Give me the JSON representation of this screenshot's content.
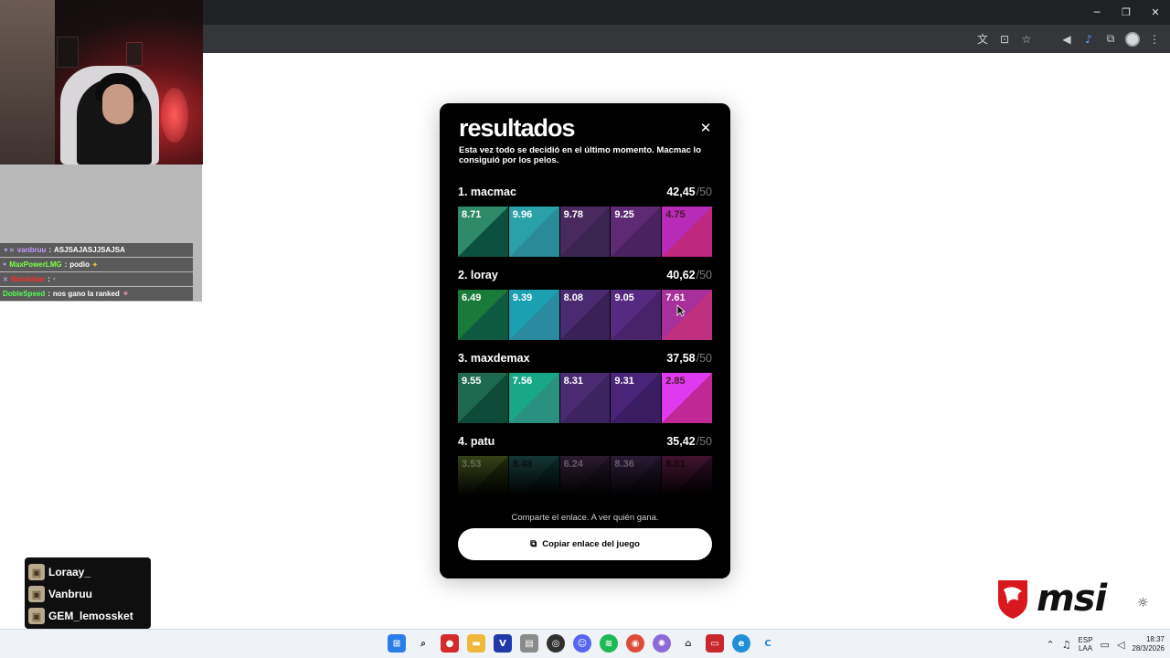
{
  "window": {
    "minimize": "─",
    "restore": "❐",
    "close": "✕"
  },
  "toolbar": {
    "icons": [
      "translate-icon",
      "install-app-icon",
      "star-icon",
      "mute-icon",
      "audio-icon",
      "extensions-icon",
      "profile-icon",
      "menu-icon"
    ]
  },
  "chat": {
    "messages": [
      {
        "user": "vanbruu",
        "color": "#c69cff",
        "text": "ASJSAJASJJSAJSA"
      },
      {
        "user": "MaxPowerLMG",
        "color": "#7dff4a",
        "text": "podio"
      },
      {
        "user": "Nandobar",
        "color": "#ff2a2a",
        "text": ""
      },
      {
        "user": "DobleSpeed",
        "color": "#55ff55",
        "text": "nos gano la ranked"
      }
    ]
  },
  "viewers": [
    "Loraay_",
    "Vanbruu",
    "GEM_lemossket"
  ],
  "brand": {
    "msi": "msi"
  },
  "results": {
    "title": "resultados",
    "subtitle": "Esta vez todo se decidió en el último momento. Macmac lo consiguió por los pelos.",
    "max_label": "/50",
    "players": [
      {
        "rank_name": "1. macmac",
        "score": "42,45",
        "values": [
          "8.71",
          "9.96",
          "9.78",
          "9.25",
          "4.75"
        ]
      },
      {
        "rank_name": "2. loray",
        "score": "40,62",
        "values": [
          "6.49",
          "9.39",
          "8.08",
          "9.05",
          "7.61"
        ]
      },
      {
        "rank_name": "3. maxdemax",
        "score": "37,58",
        "values": [
          "9.55",
          "7.56",
          "8.31",
          "9.31",
          "2.85"
        ]
      },
      {
        "rank_name": "4. patu",
        "score": "35,42",
        "values": [
          "3.53",
          "8.48",
          "6.24",
          "8.36",
          "8.81"
        ]
      }
    ],
    "share_text": "Comparte el enlace. A ver quién gana.",
    "copy_button": "Copiar enlace del juego"
  },
  "tile_colors": [
    [
      "#2e8a68",
      "#0c5040",
      "#2aa0a8",
      "#2a8a98",
      "#4a2a5e",
      "#3a2450",
      "#5e2a74",
      "#4a2262",
      "#b82ab8",
      "#c02880"
    ],
    [
      "#1a7a3a",
      "#0e5a40",
      "#1aa0b0",
      "#2a8aa0",
      "#4a2a70",
      "#3a2258",
      "#562a80",
      "#48226a",
      "#a8309a",
      "#c0307e"
    ],
    [
      "#1e6a50",
      "#0e4a38",
      "#18a888",
      "#2a9080",
      "#4a2a70",
      "#3c2460",
      "#4a2478",
      "#3a1c62",
      "#e03af0",
      "#c02898"
    ],
    [
      "#4a5a20",
      "#2a3a10",
      "#1a4a48",
      "#0e3a3a",
      "#3a2440",
      "#2a1a30",
      "#3a2448",
      "#2a1a38",
      "#5a1a40",
      "#3a1030"
    ]
  ],
  "taskbar": {
    "apps": [
      "start-icon",
      "search-icon",
      "app-red-icon",
      "file-explorer-icon",
      "v-app-icon",
      "files-icon",
      "obs-icon",
      "discord-icon",
      "spotify-icon",
      "chrome-icon",
      "app-swirl-icon",
      "app-arc-icon",
      "app-stream-icon",
      "edge-icon",
      "app-c-icon"
    ],
    "lang_top": "ESP",
    "lang_bottom": "LAA",
    "time": "18:37",
    "date": "28/3/2026"
  }
}
